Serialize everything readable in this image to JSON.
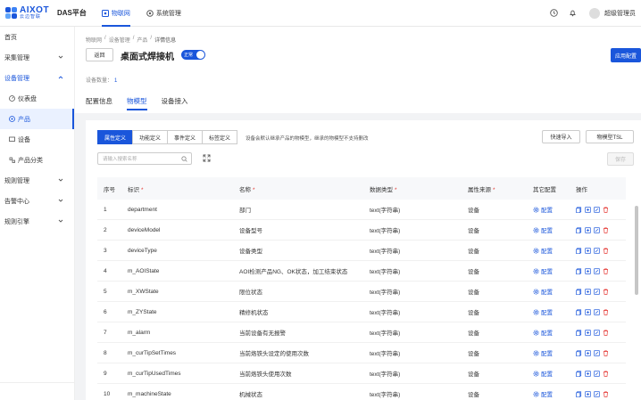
{
  "app": {
    "logo_en": "AIXOT",
    "logo_cn": "云边智联",
    "platform": "DAS平台",
    "nav_tabs": [
      {
        "label": "物联网",
        "active": true
      },
      {
        "label": "系统管理",
        "active": false
      }
    ],
    "user_name": "超级管理员"
  },
  "sidebar": {
    "items": [
      {
        "label": "首页",
        "type": "top"
      },
      {
        "label": "采集管理",
        "type": "group"
      },
      {
        "label": "设备管理",
        "type": "group-open"
      },
      {
        "label": "仪表盘",
        "type": "sub"
      },
      {
        "label": "产品",
        "type": "sub-active"
      },
      {
        "label": "设备",
        "type": "sub"
      },
      {
        "label": "产品分类",
        "type": "sub"
      },
      {
        "label": "规则管理",
        "type": "group"
      },
      {
        "label": "告警中心",
        "type": "group"
      },
      {
        "label": "规则引擎",
        "type": "group"
      }
    ]
  },
  "header": {
    "breadcrumb": [
      "物联网",
      "设备管理",
      "产品",
      "详情信息"
    ],
    "back_label": "返回",
    "title": "桌面式焊接机",
    "toggle_label": "正常",
    "apply_label": "应用配置",
    "device_count_label": "设备数量：",
    "device_count": "1",
    "tabs": [
      {
        "label": "配置信息",
        "active": false
      },
      {
        "label": "物模型",
        "active": true
      },
      {
        "label": "设备接入",
        "active": false
      }
    ]
  },
  "content": {
    "seg_tabs": [
      {
        "label": "属性定义",
        "active": true
      },
      {
        "label": "功能定义",
        "active": false
      },
      {
        "label": "事件定义",
        "active": false
      },
      {
        "label": "标签定义",
        "active": false
      }
    ],
    "hint": "设备会默认继承产品的物模型，继承的物模型不支持删改",
    "quick_import": "快速导入",
    "tsl": "物模型TSL",
    "search_placeholder": "请输入搜索名称",
    "save_label": "保存",
    "columns": [
      "序号",
      "标识",
      "名称",
      "数据类型",
      "属性来源",
      "其它配置",
      "操作"
    ],
    "required_cols": [
      1,
      2,
      3,
      4
    ],
    "config_label": "配置",
    "rows": [
      {
        "no": "1",
        "id": "department",
        "name": "部门",
        "type": "text(字符串)",
        "source": "设备"
      },
      {
        "no": "2",
        "id": "deviceModel",
        "name": "设备型号",
        "type": "text(字符串)",
        "source": "设备"
      },
      {
        "no": "3",
        "id": "deviceType",
        "name": "设备类型",
        "type": "text(字符串)",
        "source": "设备"
      },
      {
        "no": "4",
        "id": "m_AOIState",
        "name": "AOI检测产品NG、OK状态，加工结束状态",
        "type": "text(字符串)",
        "source": "设备"
      },
      {
        "no": "5",
        "id": "m_XWState",
        "name": "限位状态",
        "type": "text(字符串)",
        "source": "设备"
      },
      {
        "no": "6",
        "id": "m_ZYState",
        "name": "精修机状态",
        "type": "text(字符串)",
        "source": "设备"
      },
      {
        "no": "7",
        "id": "m_alarm",
        "name": "当前设备有无报警",
        "type": "text(字符串)",
        "source": "设备"
      },
      {
        "no": "8",
        "id": "m_curTipSetTimes",
        "name": "当前烙铁头设定的使用次数",
        "type": "text(字符串)",
        "source": "设备"
      },
      {
        "no": "9",
        "id": "m_curTipUsedTimes",
        "name": "当前烙铁头使用次数",
        "type": "text(字符串)",
        "source": "设备"
      },
      {
        "no": "10",
        "id": "m_machineState",
        "name": "机械状态",
        "type": "text(字符串)",
        "source": "设备"
      }
    ]
  },
  "colors": {
    "accent": "#1a56db",
    "required": "#e53935",
    "delete": "#e53935"
  }
}
